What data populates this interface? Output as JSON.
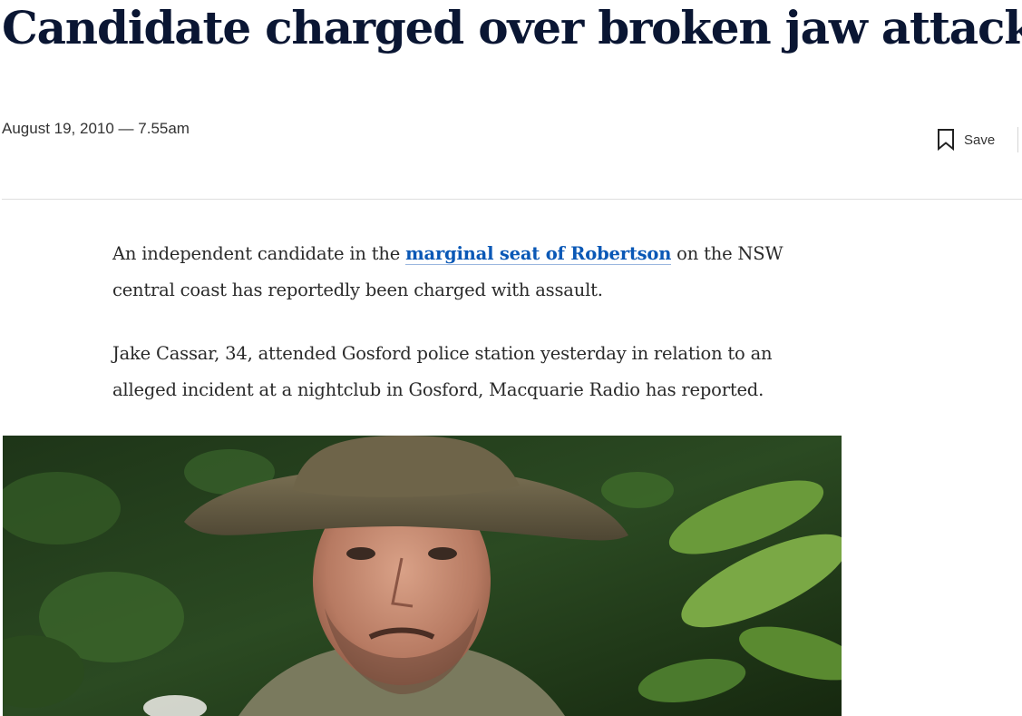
{
  "article": {
    "headline": "Candidate charged over broken jaw attack",
    "dateline": "August 19, 2010 — 7.55am",
    "save_label": "Save",
    "paragraphs": [
      {
        "before_link": "An independent candidate in the ",
        "link_text": "marginal seat of Robertson",
        "after_link": " on the NSW central coast has reportedly been charged with assault."
      },
      {
        "text": "Jake Cassar, 34, attended Gosford police station yesterday in relation to an alleged incident at a nightclub in Gosford, Macquarie Radio has reported."
      }
    ]
  },
  "icons": {
    "save": "bookmark-icon"
  },
  "colors": {
    "headline": "#0a1633",
    "link": "#0a58b6",
    "divider": "#dedede"
  }
}
